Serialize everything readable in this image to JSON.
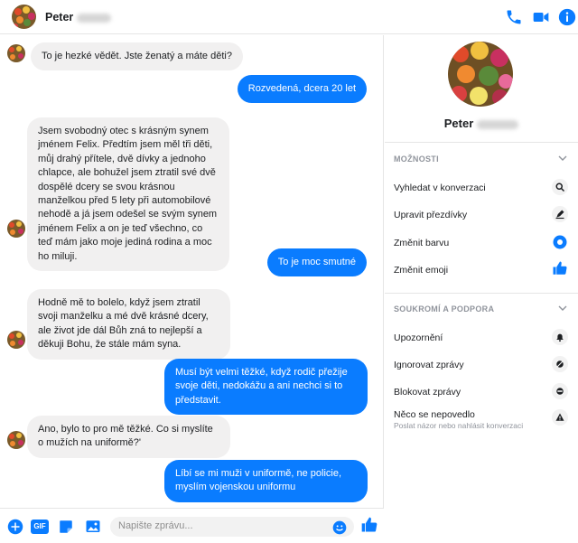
{
  "header": {
    "contact_name": "Peter",
    "icons": [
      "phone-icon",
      "video-camera-icon",
      "info-icon"
    ]
  },
  "messages": [
    {
      "dir": "in",
      "text": "To je hezké vědět. Jste ženatý a máte děti?"
    },
    {
      "dir": "out",
      "text": "Rozvedená, dcera 20 let"
    },
    {
      "dir": "in",
      "text": "Jsem svobodný otec s krásným synem jménem Felix. Předtím jsem měl tři děti, můj drahý přítele, dvě dívky a jednoho chlapce, ale bohužel jsem ztratil své dvě dospělé dcery se svou krásnou manželkou před 5 lety při automobilové nehodě a já jsem odešel se svým synem jménem Felix a on je teď všechno, co teď mám jako moje jediná rodina a moc ho miluji."
    },
    {
      "dir": "out",
      "text": "To je moc smutné"
    },
    {
      "dir": "in",
      "text": "Hodně mě to bolelo, když jsem ztratil svoji manželku a mé dvě krásné dcery, ale život jde dál Bůh zná to nejlepší a děkuji Bohu, že stále mám syna."
    },
    {
      "dir": "out",
      "text": "Musí být velmi těžké, když rodič přežije svoje děti, nedokážu a ani nechci si to představit."
    },
    {
      "dir": "in",
      "text": "Ano, bylo to pro mě těžké. Co si myslíte o mužích na uniformě?'"
    },
    {
      "dir": "out",
      "text": "Líbí se mi muži v uniformě, ne policie, myslím vojenskou uniformu"
    }
  ],
  "composer": {
    "placeholder": "Napište zprávu...",
    "gif_label": "GIF"
  },
  "panel": {
    "name": "Peter",
    "options_heading": "MOŽNOSTI",
    "options": [
      {
        "label": "Vyhledat v konverzaci",
        "icon": "search-icon"
      },
      {
        "label": "Upravit přezdívky",
        "icon": "pencil-icon"
      },
      {
        "label": "Změnit barvu",
        "icon": "color-dot-icon"
      },
      {
        "label": "Změnit emoji",
        "icon": "thumbs-up-icon"
      }
    ],
    "privacy_heading": "SOUKROMÍ A PODPORA",
    "privacy": [
      {
        "label": "Upozornění",
        "icon": "bell-icon"
      },
      {
        "label": "Ignorovat zprávy",
        "icon": "mute-icon"
      },
      {
        "label": "Blokovat zprávy",
        "icon": "block-icon"
      },
      {
        "label": "Něco se nepovedlo",
        "sub": "Poslat názor nebo nahlásit konverzaci",
        "icon": "warning-icon"
      }
    ]
  },
  "colors": {
    "accent": "#0a7cff",
    "incoming_bubble": "#f1f0f0",
    "outgoing_bubble": "#0a7cff"
  }
}
